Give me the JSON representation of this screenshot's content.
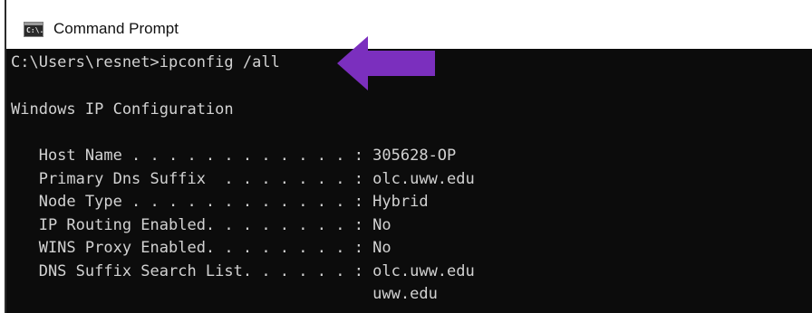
{
  "window": {
    "title": "Command Prompt",
    "icon": "command-prompt-icon",
    "icon_text": "C:\\."
  },
  "console": {
    "prompt_line": "C:\\Users\\resnet>ipconfig /all",
    "heading": "Windows IP Configuration",
    "rows": [
      "   Host Name . . . . . . . . . . . . : 305628-OP",
      "   Primary Dns Suffix  . . . . . . . : olc.uww.edu",
      "   Node Type . . . . . . . . . . . . : Hybrid",
      "   IP Routing Enabled. . . . . . . . : No",
      "   WINS Proxy Enabled. . . . . . . . : No",
      "   DNS Suffix Search List. . . . . . : olc.uww.edu",
      "                                       uww.edu"
    ]
  },
  "annotation": {
    "arrow_color": "#7b2fbe",
    "arrow_icon": "left-arrow-icon"
  },
  "colors": {
    "console_background": "#0c0c0c",
    "console_text": "#d2d2d2",
    "titlebar_background": "#ffffff"
  }
}
